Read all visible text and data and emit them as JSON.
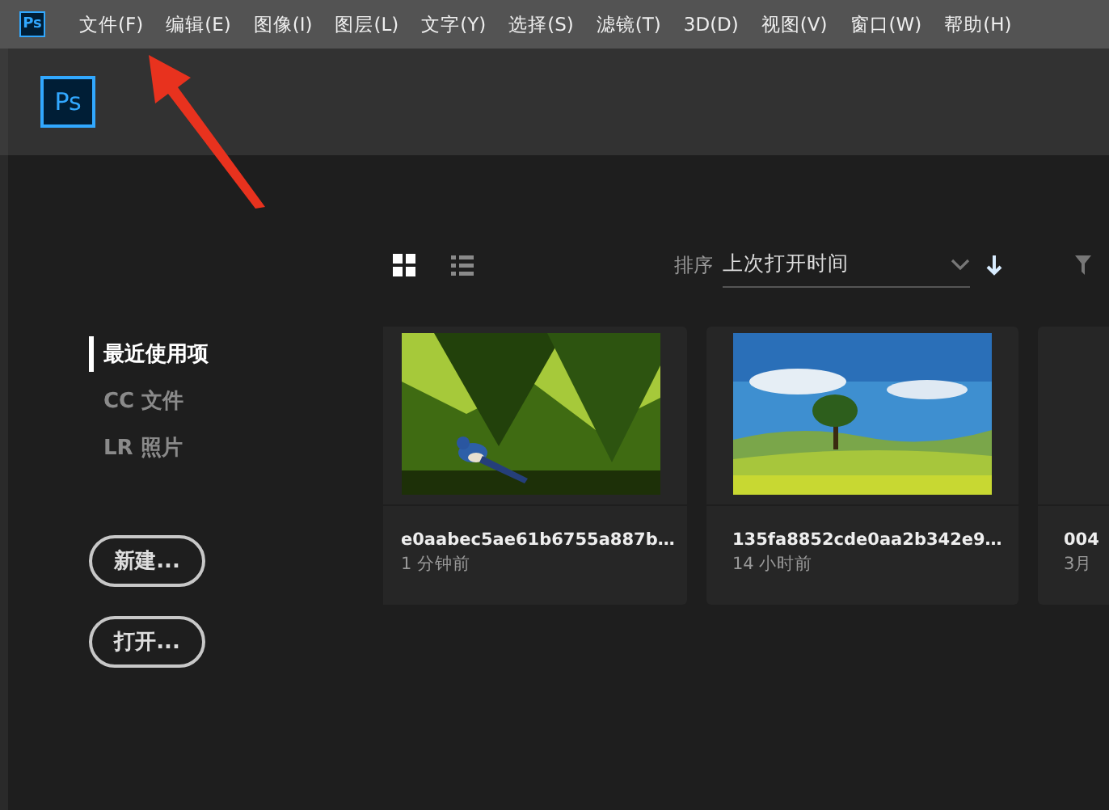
{
  "app_icon": {
    "label": "Ps"
  },
  "menu": [
    {
      "label": "文件(F)"
    },
    {
      "label": "编辑(E)"
    },
    {
      "label": "图像(I)"
    },
    {
      "label": "图层(L)"
    },
    {
      "label": "文字(Y)"
    },
    {
      "label": "选择(S)"
    },
    {
      "label": "滤镜(T)"
    },
    {
      "label": "3D(D)"
    },
    {
      "label": "视图(V)"
    },
    {
      "label": "窗口(W)"
    },
    {
      "label": "帮助(H)"
    }
  ],
  "logo": {
    "label": "Ps"
  },
  "view_toggle": [
    {
      "kind": "grid",
      "selected": true
    },
    {
      "kind": "list",
      "selected": false
    }
  ],
  "sort": {
    "label": "排序",
    "value": "上次打开时间"
  },
  "sidebar": {
    "items": [
      {
        "label": "最近使用项",
        "selected": true
      },
      {
        "label": "CC 文件",
        "selected": false
      },
      {
        "label": "LR 照片",
        "selected": false
      }
    ],
    "buttons": [
      {
        "label": "新建..."
      },
      {
        "label": "打开..."
      }
    ]
  },
  "files": [
    {
      "kind": "forest",
      "title": "e0aabec5ae61b6755a887b…",
      "time": "1 分钟前"
    },
    {
      "kind": "meadow",
      "title": "135fa8852cde0aa2b342e9…",
      "time": "14 小时前"
    },
    {
      "kind": "blank",
      "title": "004",
      "time": "3月"
    }
  ]
}
